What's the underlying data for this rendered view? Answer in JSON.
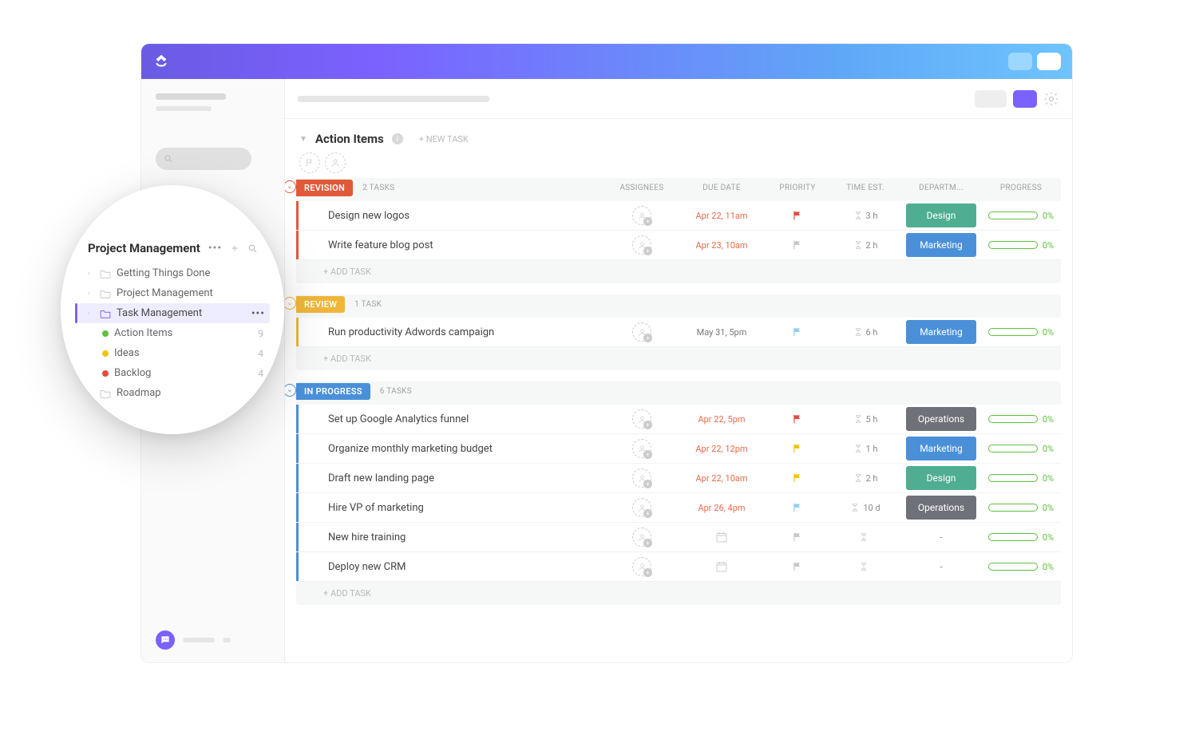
{
  "list": {
    "title": "Action Items",
    "new_task_label": "+ NEW TASK",
    "add_task_label": "+ ADD TASK"
  },
  "columns": {
    "assignees": "ASSIGNEES",
    "due": "DUE DATE",
    "priority": "PRIORITY",
    "time": "TIME EST.",
    "dept": "DEPARTM...",
    "progress": "PROGRESS"
  },
  "statuses": [
    {
      "name": "REVISION",
      "color": "#E05A3A",
      "count_label": "2 TASKS",
      "tasks": [
        {
          "title": "Design new logos",
          "due": "Apr 22, 11am",
          "due_style": "red",
          "flag": "#E74C3C",
          "time": "3 h",
          "dept": "Design",
          "dept_class": "dept-design",
          "progress": "0%"
        },
        {
          "title": "Write feature blog post",
          "due": "Apr 23, 10am",
          "due_style": "red",
          "flag": "#c8c8c8",
          "time": "2 h",
          "dept": "Marketing",
          "dept_class": "dept-marketing",
          "progress": "0%"
        }
      ]
    },
    {
      "name": "REVIEW",
      "color": "#F0B63A",
      "count_label": "1 TASK",
      "tasks": [
        {
          "title": "Run productivity Adwords campaign",
          "due": "May 31, 5pm",
          "due_style": "norm",
          "flag": "#8FD0F2",
          "time": "6 h",
          "dept": "Marketing",
          "dept_class": "dept-marketing",
          "progress": "0%"
        }
      ]
    },
    {
      "name": "IN PROGRESS",
      "color": "#4A90D9",
      "count_label": "6 TASKS",
      "tasks": [
        {
          "title": "Set up Google Analytics funnel",
          "due": "Apr 22, 5pm",
          "due_style": "red",
          "flag": "#E74C3C",
          "time": "5 h",
          "dept": "Operations",
          "dept_class": "dept-operations",
          "progress": "0%"
        },
        {
          "title": "Organize monthly marketing budget",
          "due": "Apr 22, 12pm",
          "due_style": "red",
          "flag": "#F1C40F",
          "time": "1 h",
          "dept": "Marketing",
          "dept_class": "dept-marketing",
          "progress": "0%"
        },
        {
          "title": "Draft new landing page",
          "due": "Apr 22, 10am",
          "due_style": "red",
          "flag": "#F1C40F",
          "time": "2 h",
          "dept": "Design",
          "dept_class": "dept-design",
          "progress": "0%"
        },
        {
          "title": "Hire VP of marketing",
          "due": "Apr 26, 4pm",
          "due_style": "red",
          "flag": "#8FD0F2",
          "time": "10 d",
          "dept": "Operations",
          "dept_class": "dept-operations",
          "progress": "0%"
        },
        {
          "title": "New hire training",
          "due": "",
          "due_style": "norm",
          "flag": "#c8c8c8",
          "time": "",
          "dept": "-",
          "dept_class": "dept-blank",
          "progress": "0%"
        },
        {
          "title": "Deploy new CRM",
          "due": "",
          "due_style": "norm",
          "flag": "#c8c8c8",
          "time": "",
          "dept": "-",
          "dept_class": "dept-blank",
          "progress": "0%"
        }
      ]
    }
  ],
  "popover": {
    "title": "Project Management",
    "items": [
      {
        "label": "Getting Things Done",
        "type": "folder"
      },
      {
        "label": "Project Management",
        "type": "folder"
      },
      {
        "label": "Task Management",
        "type": "folder-open",
        "active": true,
        "children": [
          {
            "label": "Action Items",
            "bullet": "b-green",
            "count": "9"
          },
          {
            "label": "Ideas",
            "bullet": "b-yellow",
            "count": "4"
          },
          {
            "label": "Backlog",
            "bullet": "b-red",
            "count": "4"
          }
        ]
      },
      {
        "label": "Roadmap",
        "type": "folder"
      }
    ]
  }
}
